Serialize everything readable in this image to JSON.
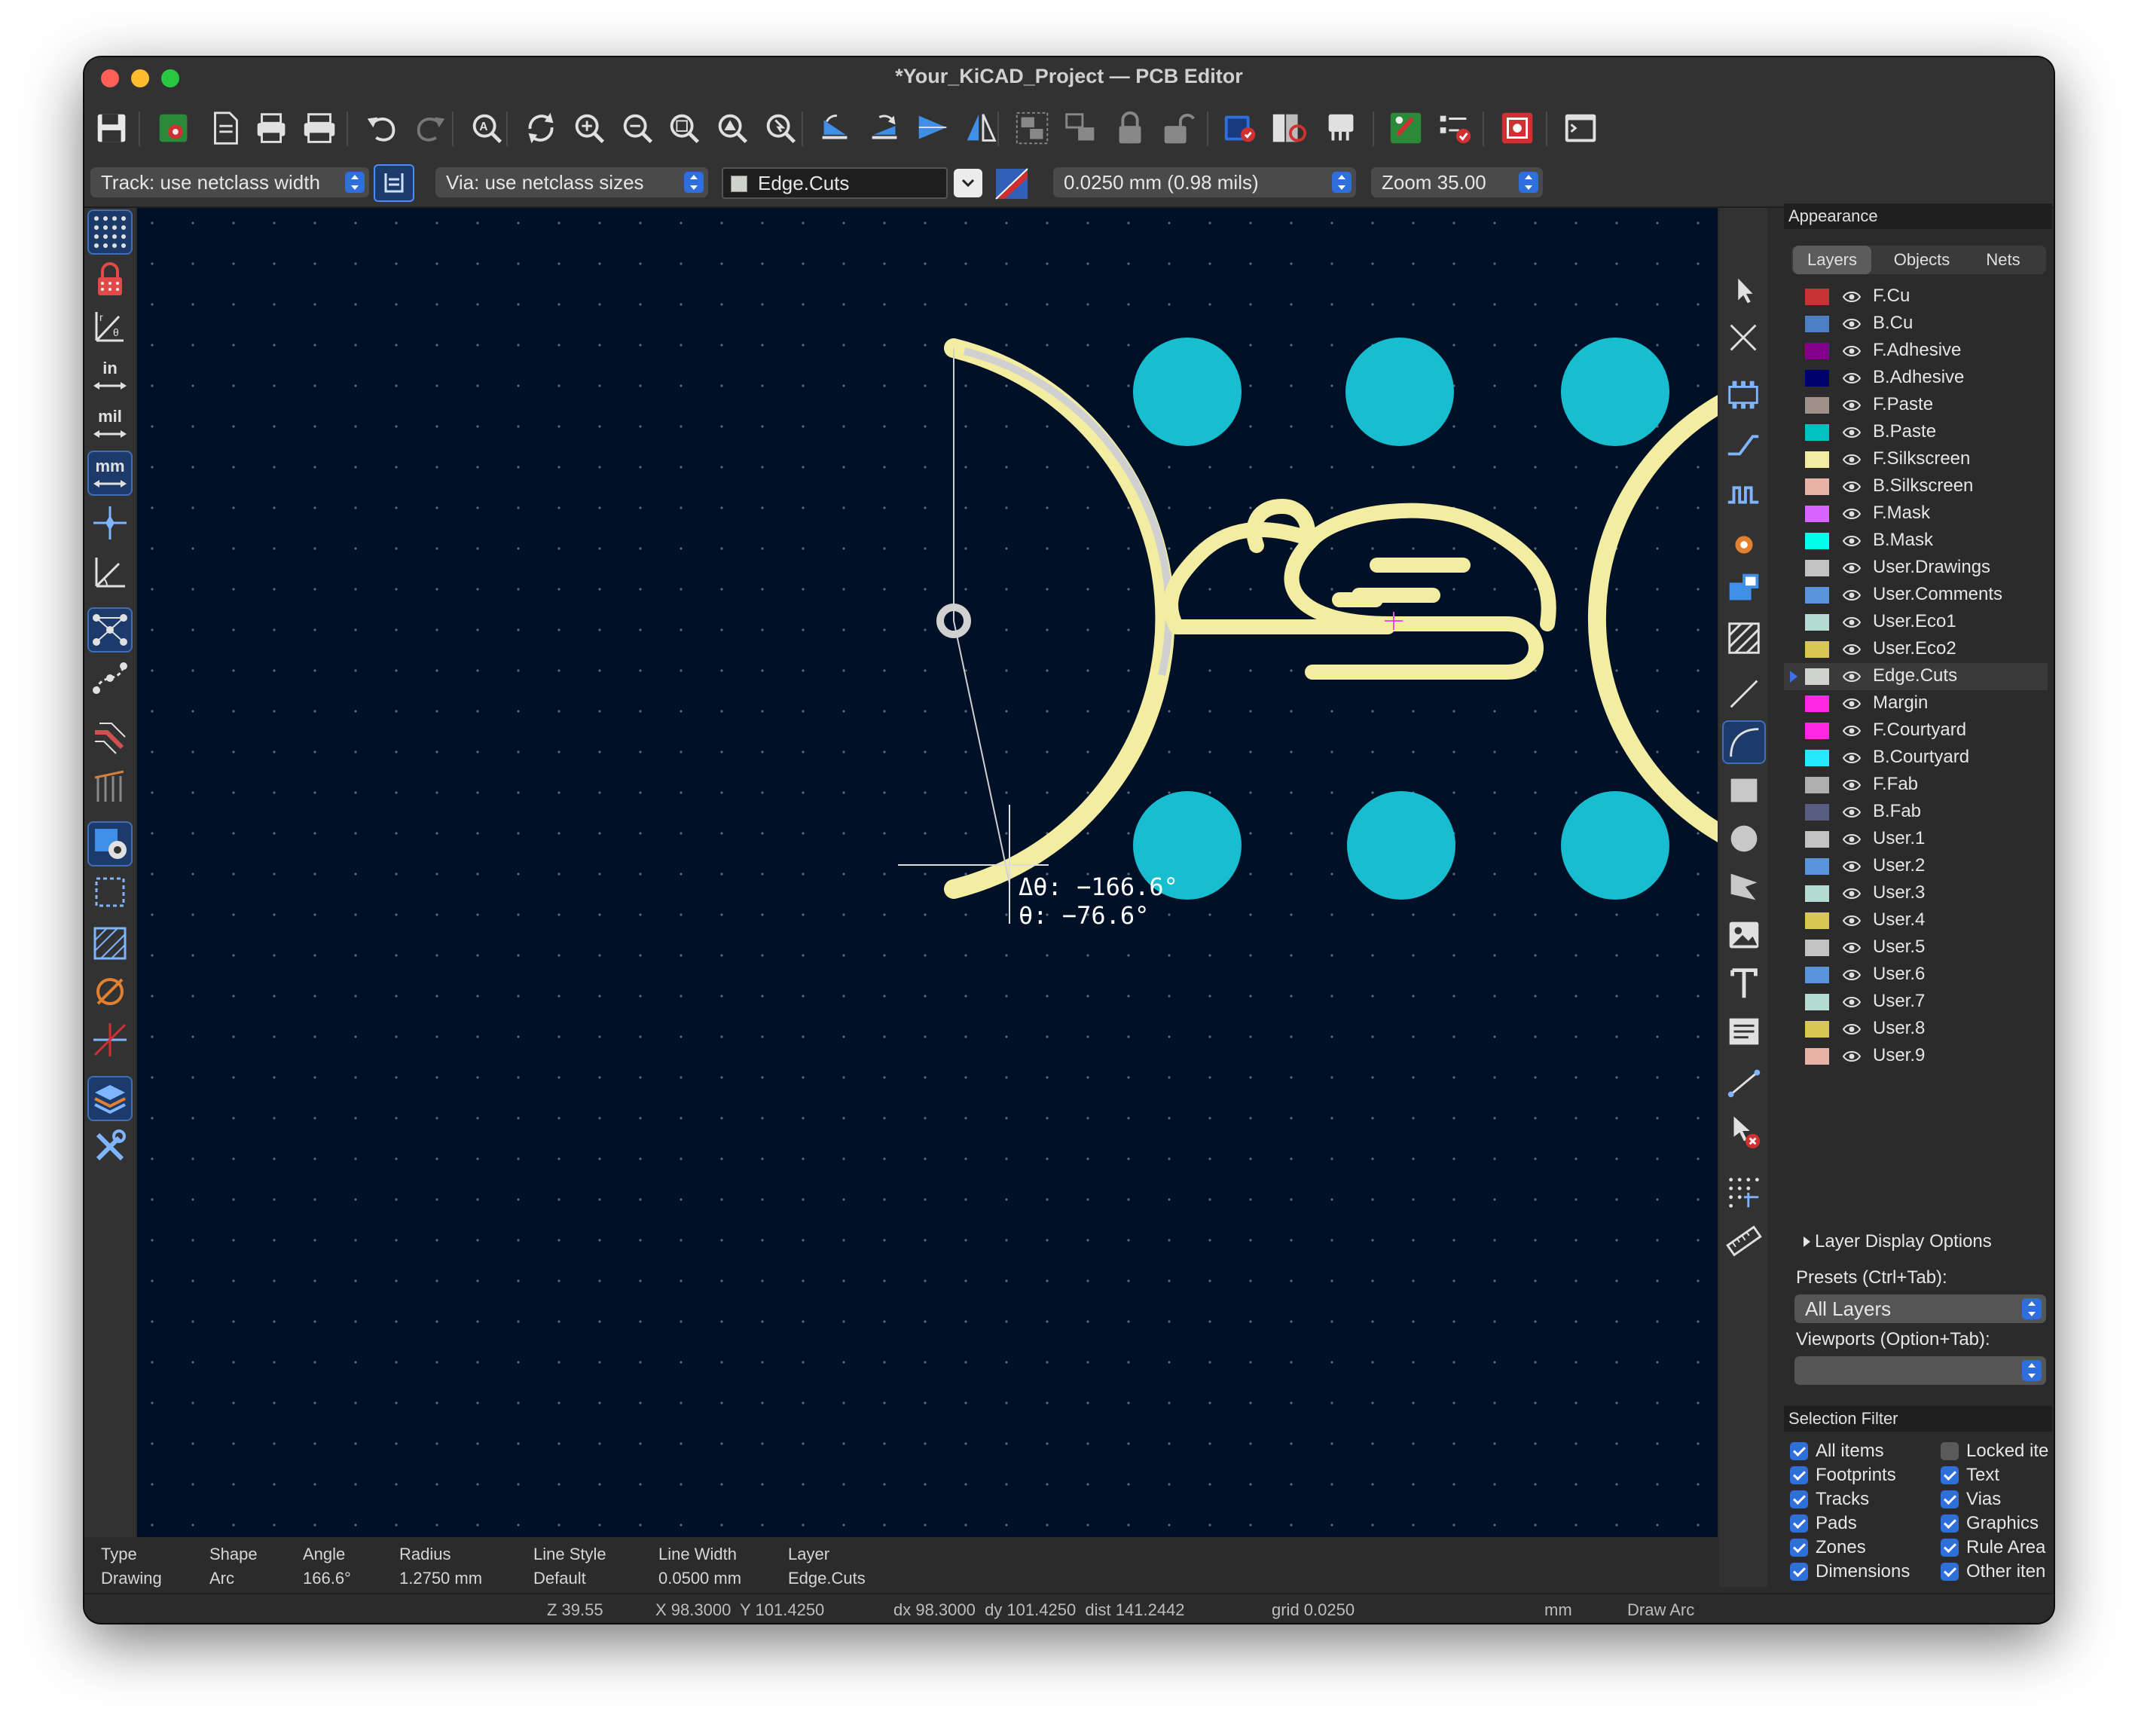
{
  "window": {
    "title": "*Your_KiCAD_Project — PCB Editor",
    "traffic_colors": [
      "#ff5f57",
      "#febc2e",
      "#28c840"
    ]
  },
  "toolbar_icons": [
    "save-icon",
    "board-setup-icon",
    "page-settings-icon",
    "print-icon",
    "plot-icon",
    "undo-icon",
    "redo-icon",
    "find-icon",
    "refresh-icon",
    "zoom-in-icon",
    "zoom-out-icon",
    "zoom-fit-icon",
    "zoom-objects-icon",
    "zoom-selection-icon",
    "rotate-ccw-icon",
    "rotate-cw-icon",
    "flip-icon",
    "mirror-icon",
    "group-icon",
    "ungroup-icon",
    "lock-icon",
    "unlock-icon",
    "update-pcb-icon",
    "footprint-browser-icon",
    "footprint-editor-icon",
    "drc-icon",
    "erc-checklist-icon",
    "schematic-icon",
    "scripting-console-icon"
  ],
  "toolbar2": {
    "track": "Track: use netclass width",
    "via": "Via: use netclass sizes",
    "layer": "Edge.Cuts",
    "grid": "0.0250 mm (0.98 mils)",
    "zoom": "Zoom 35.00"
  },
  "left_tools": [
    {
      "name": "grid-icon",
      "active": true
    },
    {
      "name": "polar-coordinates-lock-icon",
      "active": false
    },
    {
      "name": "polar-coordinates-icon",
      "active": false
    },
    {
      "name": "inches-unit-icon",
      "label": "in",
      "active": false
    },
    {
      "name": "mils-unit-icon",
      "label": "mil",
      "active": false
    },
    {
      "name": "millimeters-unit-icon",
      "label": "mm",
      "active": true
    },
    {
      "name": "full-crosshair-icon",
      "active": false
    },
    {
      "name": "angle-snap-icon",
      "active": false
    },
    {
      "name": "ratsnest-icon",
      "active": true
    },
    {
      "name": "curved-ratsnest-icon",
      "active": false
    },
    {
      "name": "track-outline-icon",
      "active": false
    },
    {
      "name": "pad-outline-icon",
      "active": false
    },
    {
      "name": "via-display-icon",
      "active": true
    },
    {
      "name": "zone-outline-icon",
      "active": false
    },
    {
      "name": "zone-fill-icon",
      "active": false
    },
    {
      "name": "net-highlight-icon",
      "active": false
    },
    {
      "name": "snap-icon",
      "active": false
    },
    {
      "name": "appearance-panel-icon",
      "active": true
    },
    {
      "name": "tools-icon",
      "active": false
    }
  ],
  "right_tools": [
    "select-arrow-icon",
    "local-ratsnest-icon",
    "place-footprint-icon",
    "route-track-icon",
    "tune-length-icon",
    "add-via-icon",
    "add-zone-icon",
    "add-rule-area-icon",
    "draw-line-icon",
    "draw-arc-icon",
    "draw-rectangle-icon",
    "draw-circle-icon",
    "draw-polygon-icon",
    "add-image-icon",
    "add-text-icon",
    "add-textbox-icon",
    "add-dimension-icon",
    "delete-tool-icon",
    "grid-origin-icon",
    "measure-icon"
  ],
  "canvas": {
    "delta_angle": "Δθ: −166.6°",
    "angle": "θ: −76.6°",
    "colors": {
      "background": "#001026",
      "pad": "#18bdcf",
      "silk": "#f2eda1",
      "edge": "#d0d0d0",
      "grid": "#5a6a7a",
      "cursor": "#dddddd",
      "anchor": "#ff44ff"
    }
  },
  "appearance": {
    "title": "Appearance",
    "tabs": [
      "Layers",
      "Objects",
      "Nets"
    ],
    "active_tab": 0,
    "layers": [
      {
        "name": "F.Cu",
        "color": "#c83434"
      },
      {
        "name": "B.Cu",
        "color": "#4d7fc4"
      },
      {
        "name": "F.Adhesive",
        "color": "#84008a"
      },
      {
        "name": "B.Adhesive",
        "color": "#00006e"
      },
      {
        "name": "F.Paste",
        "color": "#a0908a"
      },
      {
        "name": "B.Paste",
        "color": "#00c2c2"
      },
      {
        "name": "F.Silkscreen",
        "color": "#f2eda1"
      },
      {
        "name": "B.Silkscreen",
        "color": "#e8b2a7"
      },
      {
        "name": "F.Mask",
        "color": "#d864ff"
      },
      {
        "name": "B.Mask",
        "color": "#02ffee"
      },
      {
        "name": "User.Drawings",
        "color": "#c2c2c2"
      },
      {
        "name": "User.Comments",
        "color": "#5994dc"
      },
      {
        "name": "User.Eco1",
        "color": "#b4dbd2"
      },
      {
        "name": "User.Eco2",
        "color": "#d8c852"
      },
      {
        "name": "Edge.Cuts",
        "color": "#d0d2cd"
      },
      {
        "name": "Margin",
        "color": "#ff26e2"
      },
      {
        "name": "F.Courtyard",
        "color": "#ff26e2"
      },
      {
        "name": "B.Courtyard",
        "color": "#26e9ff"
      },
      {
        "name": "F.Fab",
        "color": "#afafaf"
      },
      {
        "name": "B.Fab",
        "color": "#585d84"
      },
      {
        "name": "User.1",
        "color": "#c2c2c2"
      },
      {
        "name": "User.2",
        "color": "#5994dc"
      },
      {
        "name": "User.3",
        "color": "#b4dbd2"
      },
      {
        "name": "User.4",
        "color": "#d8c852"
      },
      {
        "name": "User.5",
        "color": "#c2c2c2"
      },
      {
        "name": "User.6",
        "color": "#5994dc"
      },
      {
        "name": "User.7",
        "color": "#b4dbd2"
      },
      {
        "name": "User.8",
        "color": "#d8c852"
      },
      {
        "name": "User.9",
        "color": "#e8b2a7"
      }
    ],
    "active_layer": "Edge.Cuts",
    "layer_display_options": "Layer Display Options",
    "presets_label": "Presets (Ctrl+Tab):",
    "presets_value": "All Layers",
    "viewports_label": "Viewports (Option+Tab):",
    "viewports_value": ""
  },
  "selection_filter": {
    "title": "Selection Filter",
    "left": [
      {
        "label": "All items",
        "checked": true
      },
      {
        "label": "Footprints",
        "checked": true
      },
      {
        "label": "Tracks",
        "checked": true
      },
      {
        "label": "Pads",
        "checked": true
      },
      {
        "label": "Zones",
        "checked": true
      },
      {
        "label": "Dimensions",
        "checked": true
      }
    ],
    "right": [
      {
        "label": "Locked ite",
        "checked": false
      },
      {
        "label": "Text",
        "checked": true
      },
      {
        "label": "Vias",
        "checked": true
      },
      {
        "label": "Graphics",
        "checked": true
      },
      {
        "label": "Rule Area",
        "checked": true
      },
      {
        "label": "Other iten",
        "checked": true
      }
    ]
  },
  "info": [
    {
      "header": "Type",
      "value": "Drawing"
    },
    {
      "header": "Shape",
      "value": "Arc"
    },
    {
      "header": "Angle",
      "value": "166.6°"
    },
    {
      "header": "Radius",
      "value": "1.2750 mm"
    },
    {
      "header": "Line Style",
      "value": "Default"
    },
    {
      "header": "Line Width",
      "value": "0.0500 mm"
    },
    {
      "header": "Layer",
      "value": "Edge.Cuts"
    }
  ],
  "status": {
    "zoom": "Z 39.55",
    "coords": "X 98.3000  Y 101.4250",
    "delta": "dx 98.3000  dy 101.4250  dist 141.2442",
    "grid": "grid 0.0250",
    "units": "mm",
    "tool": "Draw Arc"
  }
}
